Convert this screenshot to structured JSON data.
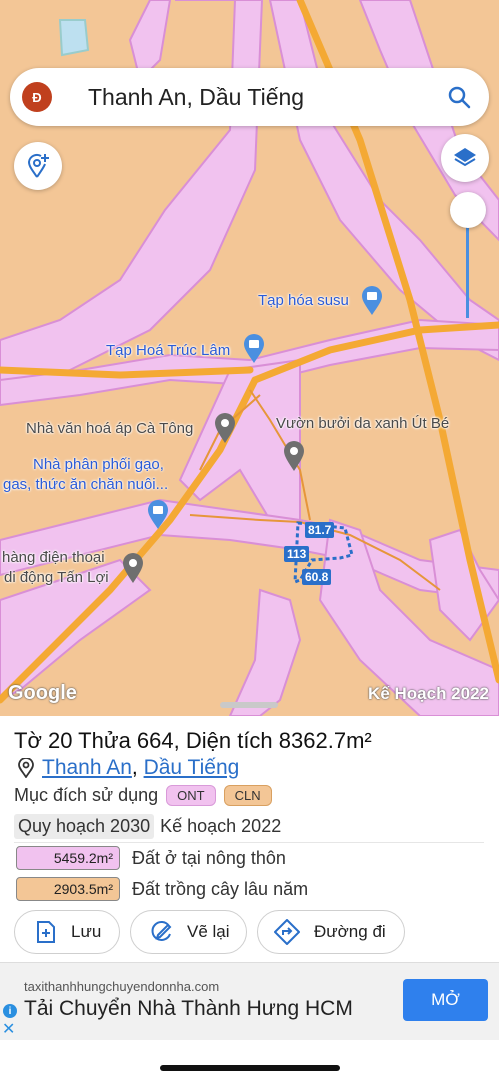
{
  "search": {
    "avatar_letter": "Đ",
    "query": "Thanh An, Dầu Tiếng"
  },
  "map": {
    "pois": [
      {
        "name": "Tạp hóa susu"
      },
      {
        "name": "Tạp Hoá Trúc Lâm"
      },
      {
        "name": "Nhà văn hoá áp Cà Tông"
      },
      {
        "name": "Vườn bưởi da xanh Út Bé"
      },
      {
        "name": "Nhà phân phối gạo,"
      },
      {
        "name": "gas, thức ăn chăn nuôi..."
      },
      {
        "name": "hàng điện thoại"
      },
      {
        "name": "di động Tấn Lợi"
      }
    ],
    "parcel_dims": [
      "81.7",
      "113",
      "60.8"
    ],
    "google_label": "Google",
    "plan_label": "Kế Hoạch 2022",
    "colors": {
      "land_orange": "#f3c696",
      "residential_pink": "#f1c2ef",
      "road_orange": "#f4a934"
    }
  },
  "parcel": {
    "title": "Tờ 20 Thửa 664, Diện tích 8362.7m²",
    "location": {
      "commune": "Thanh An",
      "separator": ", ",
      "district": "Dầu Tiếng"
    },
    "purpose_label": "Mục đích sử dụng",
    "tags": [
      {
        "code": "ONT",
        "color": "#f1c2ef"
      },
      {
        "code": "CLN",
        "color": "#f3c696"
      }
    ],
    "tabs": {
      "active": "Quy hoạch 2030",
      "inactive": "Kế hoạch 2022"
    },
    "areas": [
      {
        "value": "5459.2m²",
        "desc": "Đất ở tại nông thôn",
        "color": "#f1c2ef"
      },
      {
        "value": "2903.5m²",
        "desc": "Đất trồng cây lâu năm",
        "color": "#f3c696"
      }
    ],
    "buttons": {
      "save": "Lưu",
      "redraw": "Vẽ lại",
      "directions": "Đường đi"
    }
  },
  "ad": {
    "url": "taxithanhhungchuyendonnha.com",
    "title": "Tải Chuyển Nhà Thành Hưng HCM",
    "cta": "MỞ"
  }
}
